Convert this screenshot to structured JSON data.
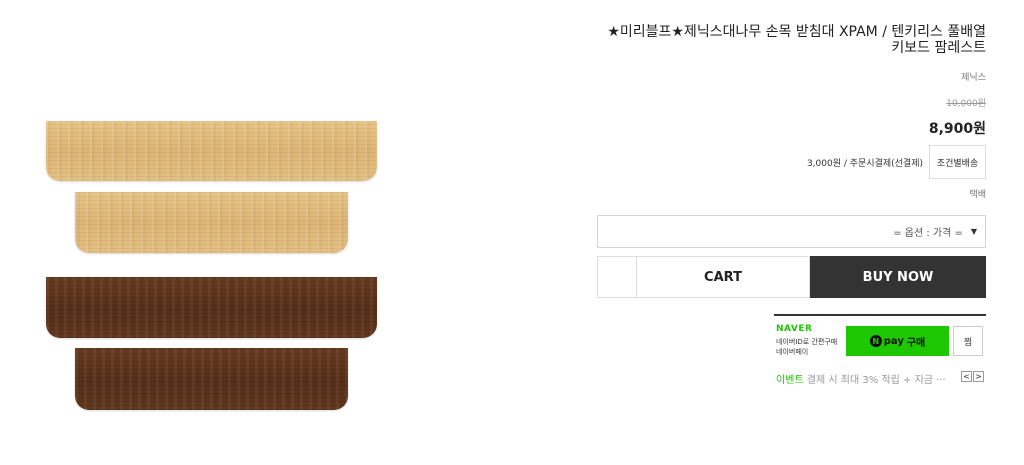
{
  "product": {
    "title": "★미리블프★제닉스대나무 손목 받침대 XPAM / 텐키리스 풀배열 키보드 팜레스트",
    "brand": "제닉스",
    "original_price": "10,000원",
    "price": "8,900원"
  },
  "shipping": {
    "fee": "3,000원  / 주문시결제(선결제)",
    "condition_button": "조건별배송",
    "type": "택배"
  },
  "options": {
    "placeholder": "= 옵션 : 가격 =",
    "caret": "▼"
  },
  "buttons": {
    "cart": "CART",
    "buy_now": "BUY NOW"
  },
  "naver_pay": {
    "logo": "NAVER",
    "desc_line1": "네이버ID로 간편구매",
    "desc_line2": "네이버페이",
    "n_symbol": "N",
    "pay_word": "pay",
    "buy_word": "구매",
    "jjim": "찜",
    "event_label": "이벤트",
    "event_text": "결제 시 최대 3% 적립 + 지금 ···",
    "prev": "<",
    "next": ">"
  },
  "colors": {
    "naver_green": "#1ec800",
    "buy_now_bg": "#333333",
    "bamboo_light": "#dcb677",
    "bamboo_dark": "#5a3119"
  }
}
